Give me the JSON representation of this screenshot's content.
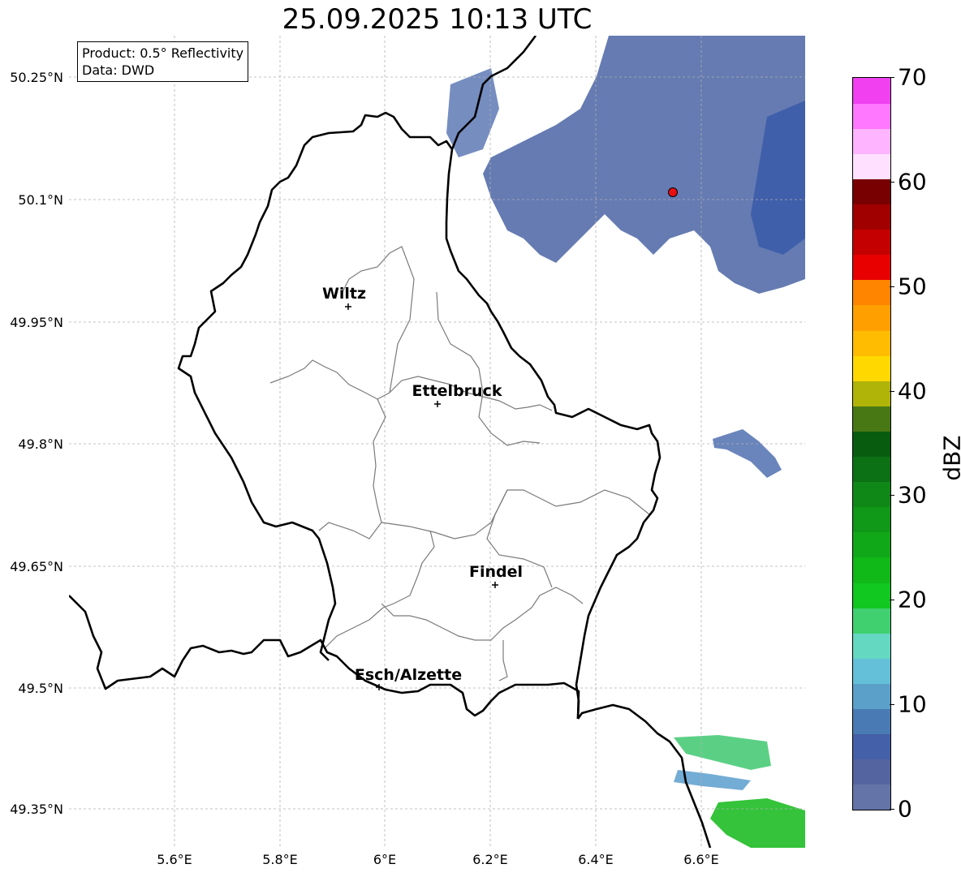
{
  "title": "25.09.2025 10:13 UTC",
  "info_box": {
    "product": "Product: 0.5° Reflectivity",
    "data": "Data: DWD"
  },
  "axes": {
    "lat_ticks": [
      "50.25°N",
      "50.1°N",
      "49.95°N",
      "49.8°N",
      "49.65°N",
      "49.5°N",
      "49.35°N"
    ],
    "lon_ticks": [
      "5.6°E",
      "5.8°E",
      "6°E",
      "6.2°E",
      "6.4°E",
      "6.6°E"
    ]
  },
  "cities": [
    {
      "name": "Wiltz"
    },
    {
      "name": "Ettelbruck"
    },
    {
      "name": "Findel"
    },
    {
      "name": "Esch/Alzette"
    }
  ],
  "radar_site_color": "#e81010",
  "colorbar": {
    "label": "dBZ",
    "ticks": [
      "0",
      "10",
      "20",
      "30",
      "40",
      "50",
      "60",
      "70"
    ],
    "min": 0,
    "max": 70,
    "colors": [
      "#6474a8",
      "#5464a0",
      "#4460a8",
      "#4a7ab4",
      "#5aa0c8",
      "#64c0d8",
      "#64d8c0",
      "#40d070",
      "#10c820",
      "#10b818",
      "#10a818",
      "#109818",
      "#108818",
      "#0c7014",
      "#085c10",
      "#487814",
      "#b0b408",
      "#ffd800",
      "#ffbc00",
      "#ffa000",
      "#ff8400",
      "#e80000",
      "#c40000",
      "#a00000",
      "#780000",
      "#ffe0ff",
      "#ffb4ff",
      "#ff78ff",
      "#f040f0"
    ]
  }
}
